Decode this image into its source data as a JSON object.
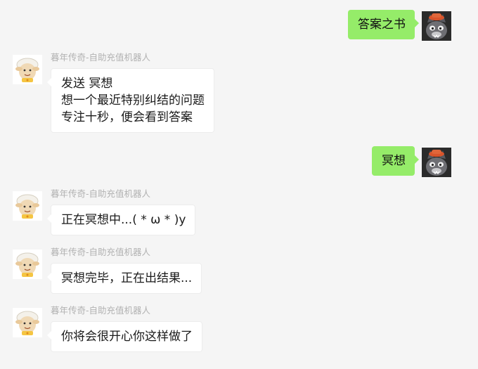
{
  "chat": {
    "bot_name": "暮年传奇-自助充值机器人",
    "messages": [
      {
        "side": "out",
        "lines": [
          "答案之书"
        ]
      },
      {
        "side": "in",
        "lines": [
          "发送 冥想",
          "想一个最近特别纠结的问题",
          "专注十秒，便会看到答案"
        ]
      },
      {
        "side": "out",
        "lines": [
          "冥想"
        ]
      },
      {
        "side": "in",
        "lines": [
          "正在冥想中...( * ω * )y"
        ]
      },
      {
        "side": "in",
        "lines": [
          "冥想完毕，正在出结果..."
        ]
      },
      {
        "side": "in",
        "lines": [
          "你将会很开心你这样做了"
        ]
      }
    ]
  },
  "colors": {
    "background": "#f5f5f5",
    "outgoing_bubble": "#95ec69",
    "incoming_bubble": "#ffffff",
    "sender_name": "#b2b2b2"
  },
  "icons": {
    "user_avatar": "wolf-avatar-icon",
    "bot_avatar": "sheep-avatar-icon"
  }
}
